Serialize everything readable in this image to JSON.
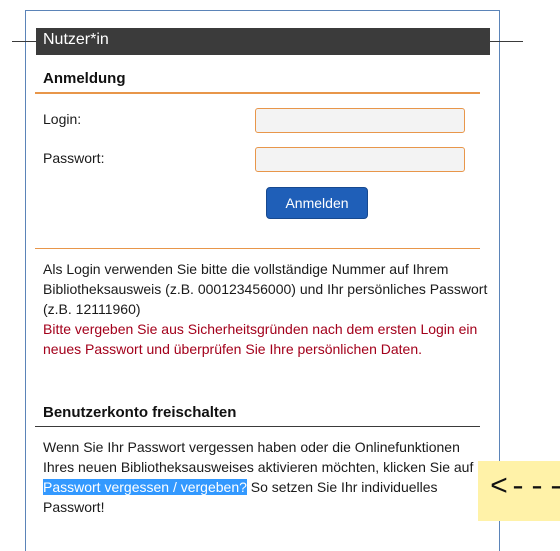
{
  "panel": {
    "title": "Nutzer*in"
  },
  "login": {
    "section_title": "Anmeldung",
    "login_label": "Login:",
    "login_value": "",
    "password_label": "Passwort:",
    "password_value": "",
    "submit_label": "Anmelden"
  },
  "info": {
    "text": "Als Login verwenden Sie bitte die vollständige Nummer auf Ihrem Bibliotheksausweis (z.B. 000123456000) und Ihr persönliches Passwort (z.B. 12111960)",
    "warning": "Bitte vergeben Sie aus Sicherheitsgründen nach dem ersten Login ein neues Passwort und überprüfen Sie Ihre persönlichen Daten."
  },
  "activate": {
    "section_title": "Benutzerkonto freischalten",
    "text_before": "Wenn Sie Ihr Passwort vergessen haben oder die Onlinefunktionen Ihres neuen Bibliotheksausweises aktivieren möchten, klicken Sie auf ",
    "link": "Passwort vergessen / vergeben?",
    "text_after": " So setzen Sie Ihr individuelles Passwort!"
  },
  "callout": {
    "text": "<---"
  },
  "colors": {
    "accent_orange": "#e8964a",
    "button_blue": "#1f5fb8",
    "warning_red": "#a3001b",
    "highlight_blue": "#3399ff",
    "callout_yellow": "#fff2a8"
  }
}
